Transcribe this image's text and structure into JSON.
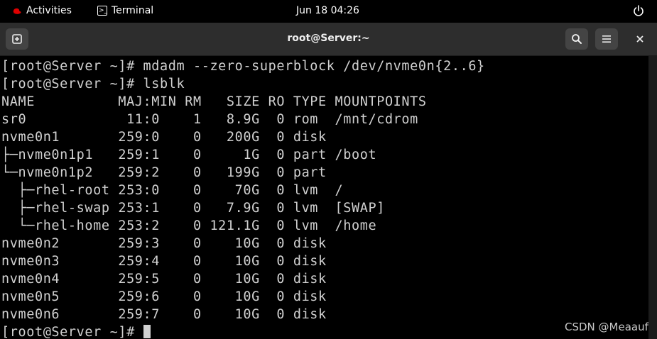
{
  "topbar": {
    "activities": "Activities",
    "app": "Terminal",
    "clock": "Jun 18  04:26"
  },
  "window": {
    "title": "root@Server:~"
  },
  "terminal": {
    "lines": [
      "[root@Server ~]# mdadm --zero-superblock /dev/nvme0n{2..6}",
      "[root@Server ~]# lsblk",
      "NAME          MAJ:MIN RM   SIZE RO TYPE MOUNTPOINTS",
      "sr0            11:0    1   8.9G  0 rom  /mnt/cdrom",
      "nvme0n1       259:0    0   200G  0 disk ",
      "├─nvme0n1p1   259:1    0     1G  0 part /boot",
      "└─nvme0n1p2   259:2    0   199G  0 part ",
      "  ├─rhel-root 253:0    0    70G  0 lvm  /",
      "  ├─rhel-swap 253:1    0   7.9G  0 lvm  [SWAP]",
      "  └─rhel-home 253:2    0 121.1G  0 lvm  /home",
      "nvme0n2       259:3    0    10G  0 disk ",
      "nvme0n3       259:4    0    10G  0 disk ",
      "nvme0n4       259:5    0    10G  0 disk ",
      "nvme0n5       259:6    0    10G  0 disk ",
      "nvme0n6       259:7    0    10G  0 disk ",
      "[root@Server ~]# "
    ]
  },
  "watermark": "CSDN @Meaauf",
  "colors": {
    "accent": "#e00000",
    "header_bg": "#2d2d2d",
    "terminal_fg": "#d0d0d0"
  },
  "icons": {
    "activities": "redhat-icon",
    "app": "terminal-icon",
    "power": "power-icon",
    "new_tab": "new-tab-icon",
    "search": "search-icon",
    "menu": "hamburger-menu-icon",
    "close": "close-icon"
  }
}
